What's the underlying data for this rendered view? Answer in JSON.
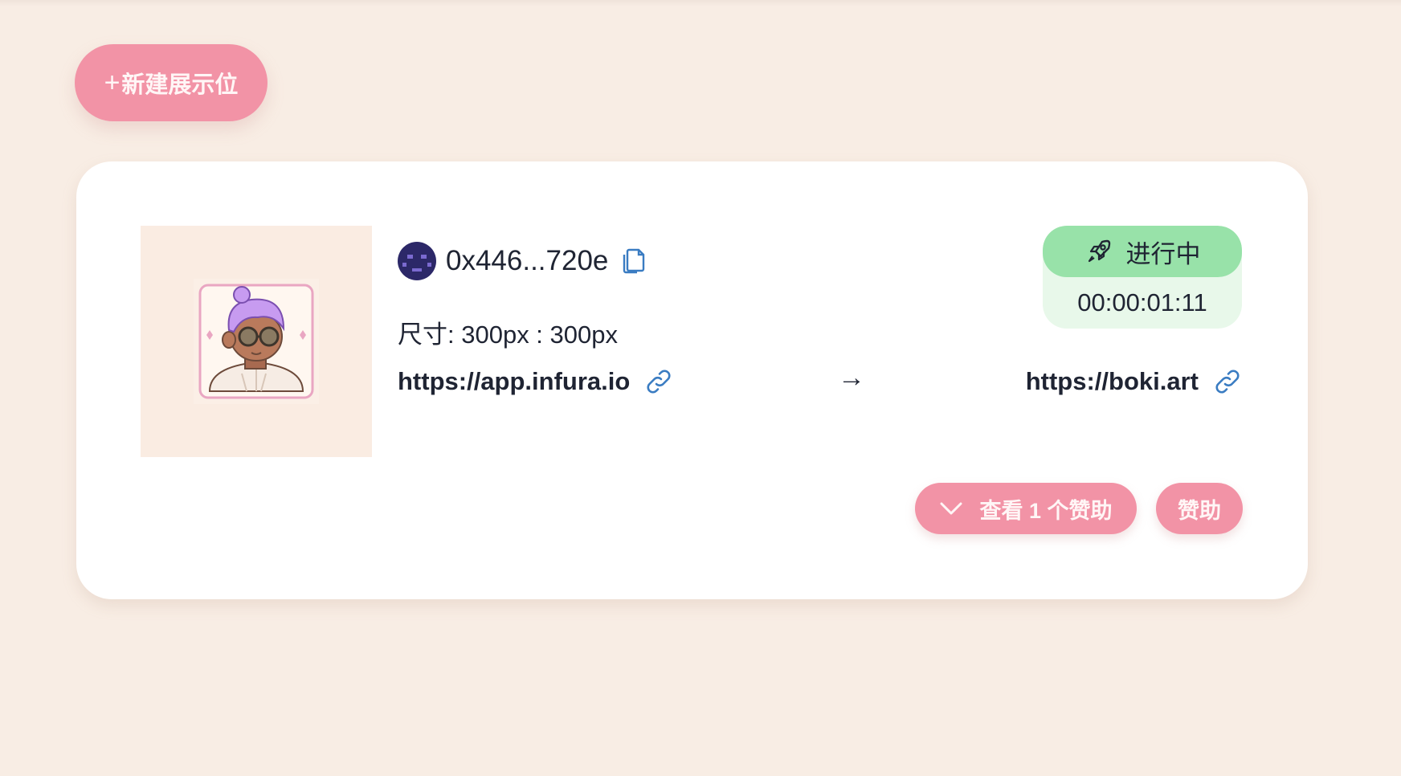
{
  "toolbar": {
    "new_button_plus": "+",
    "new_button_label": "新建展示位"
  },
  "slot": {
    "owner_address": "0x446...720e",
    "size_text": "尺寸: 300px : 300px",
    "source_url": "https://app.infura.io",
    "arrow": "→",
    "target_url": "https://boki.art",
    "status_label": "进行中",
    "status_timer": "00:00:01:11",
    "view_sponsors_label": "查看 1 个赞助",
    "sponsor_button_label": "赞助"
  },
  "colors": {
    "background": "#f8ede4",
    "accent_pink": "#f293a6",
    "status_green": "#98e2a9",
    "status_green_light": "#e8f8ea",
    "link_icon_blue": "#3a7cc2"
  },
  "icons": {
    "copy": "copy-icon",
    "link": "link-icon",
    "status": "rocket-icon",
    "expand": "chevron-down-icon"
  }
}
